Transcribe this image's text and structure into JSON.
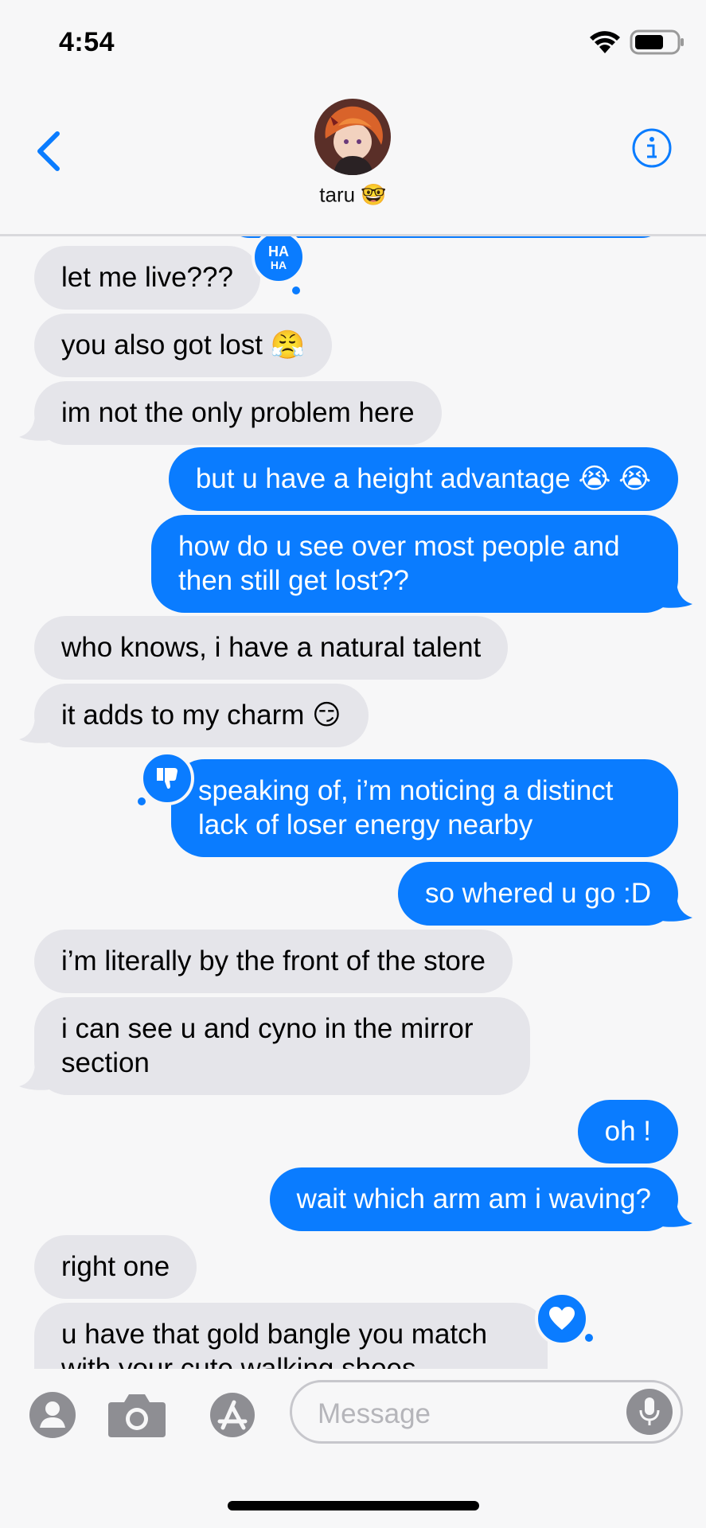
{
  "status": {
    "time": "4:54"
  },
  "header": {
    "contact_name": "taru",
    "contact_emoji": "🤓"
  },
  "messages": [
    {
      "text": "let me live???"
    },
    {
      "text": "you also got lost 😤"
    },
    {
      "text": "im not the only problem here"
    },
    {
      "text": "but u have a height advantage 😭 😭"
    },
    {
      "text": "how do u see over most people and",
      "text2": "then still get lost??"
    },
    {
      "text": "who knows, i have a natural talent"
    },
    {
      "text": "it adds to my charm 😏"
    },
    {
      "text": "speaking of, i’m noticing a distinct",
      "text2": "lack of loser energy nearby"
    },
    {
      "text": "so whered u go :D"
    },
    {
      "text": "i’m literally by the front of the store"
    },
    {
      "text": "i can see u and cyno in the mirror",
      "text2": "section"
    },
    {
      "text": "oh !"
    },
    {
      "text": "wait which arm am i waving?"
    },
    {
      "text": "right one"
    },
    {
      "text": "u have that gold bangle you match",
      "text2": "with your cute walking shoes"
    }
  ],
  "reactions": {
    "haha_top": "HA",
    "haha_bottom": "HA"
  },
  "composer": {
    "placeholder": "Message"
  },
  "colors": {
    "sent_bubble": "#0a7cff",
    "received_bubble": "#e5e5ea",
    "accent": "#0a7cff"
  },
  "icons": [
    "back-chevron-icon",
    "info-icon",
    "wifi-icon",
    "battery-icon",
    "contacts-icon",
    "camera-icon",
    "app-store-icon",
    "microphone-icon",
    "haha-reaction-icon",
    "thumbs-down-reaction-icon",
    "heart-reaction-icon"
  ]
}
